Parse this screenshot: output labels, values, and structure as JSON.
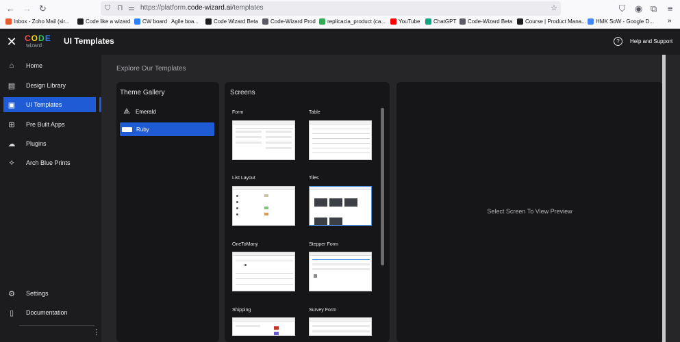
{
  "browser": {
    "url_prefix": "https://platform.",
    "url_domain": "code-wizard.ai",
    "url_path": "/templates",
    "bookmarks": [
      {
        "label": "Inbox - Zoho Mail (sir...",
        "color": "#e55b2d"
      },
      {
        "label": "Code like a wizard",
        "color": "#1c1c1e"
      },
      {
        "label": "CW board",
        "color": "#2d7ff9"
      },
      {
        "label": "Agile boa...",
        "color": "#2684ff"
      },
      {
        "label": "Code Wizard Beta",
        "color": "#1c1c1e"
      },
      {
        "label": "Code-Wizard Prod",
        "color": "#5b5b66"
      },
      {
        "label": "replicacia_product (ca...",
        "color": "#34a853"
      },
      {
        "label": "YouTube",
        "color": "#ff0000"
      },
      {
        "label": "ChatGPT",
        "color": "#10a37f"
      },
      {
        "label": "Code-Wizard Beta",
        "color": "#5b5b66"
      },
      {
        "label": "Course | Product Mana...",
        "color": "#1c1c1e"
      },
      {
        "label": "HMK SoW - Google D...",
        "color": "#4285f4"
      }
    ]
  },
  "app": {
    "title": "UI Templates",
    "logo_top": "CODE",
    "logo_bottom": "wizard",
    "help_label": "Help and Support",
    "accent": "#1e5bd4"
  },
  "sidebar": {
    "items": [
      {
        "label": "Home",
        "icon": "home-icon",
        "glyph": "⌂"
      },
      {
        "label": "Design Library",
        "icon": "design-library-icon",
        "glyph": "▤"
      },
      {
        "label": "UI Templates",
        "icon": "ui-templates-icon",
        "glyph": "▣"
      },
      {
        "label": "Pre Built Apps",
        "icon": "pre-built-apps-icon",
        "glyph": "⊞"
      },
      {
        "label": "Plugins",
        "icon": "plugins-icon",
        "glyph": "☁"
      },
      {
        "label": "Arch Blue Prints",
        "icon": "arch-blueprints-icon",
        "glyph": "⟡"
      }
    ],
    "bottom_items": [
      {
        "label": "Settings",
        "icon": "settings-icon",
        "glyph": "⚙"
      },
      {
        "label": "Documentation",
        "icon": "documentation-icon",
        "glyph": "▯"
      }
    ]
  },
  "main": {
    "heading": "Explore Our Templates",
    "theme_gallery": {
      "title": "Theme Gallery",
      "themes": [
        "Emerald",
        "Ruby"
      ],
      "selected": "Ruby"
    },
    "screens": {
      "title": "Screens",
      "items": [
        "Form",
        "Table",
        "List Layout",
        "Tiles",
        "OneToMany",
        "Stepper Form",
        "Shipping",
        "Survey Form"
      ]
    },
    "preview": {
      "placeholder": "Select Screen To View Preview"
    }
  }
}
